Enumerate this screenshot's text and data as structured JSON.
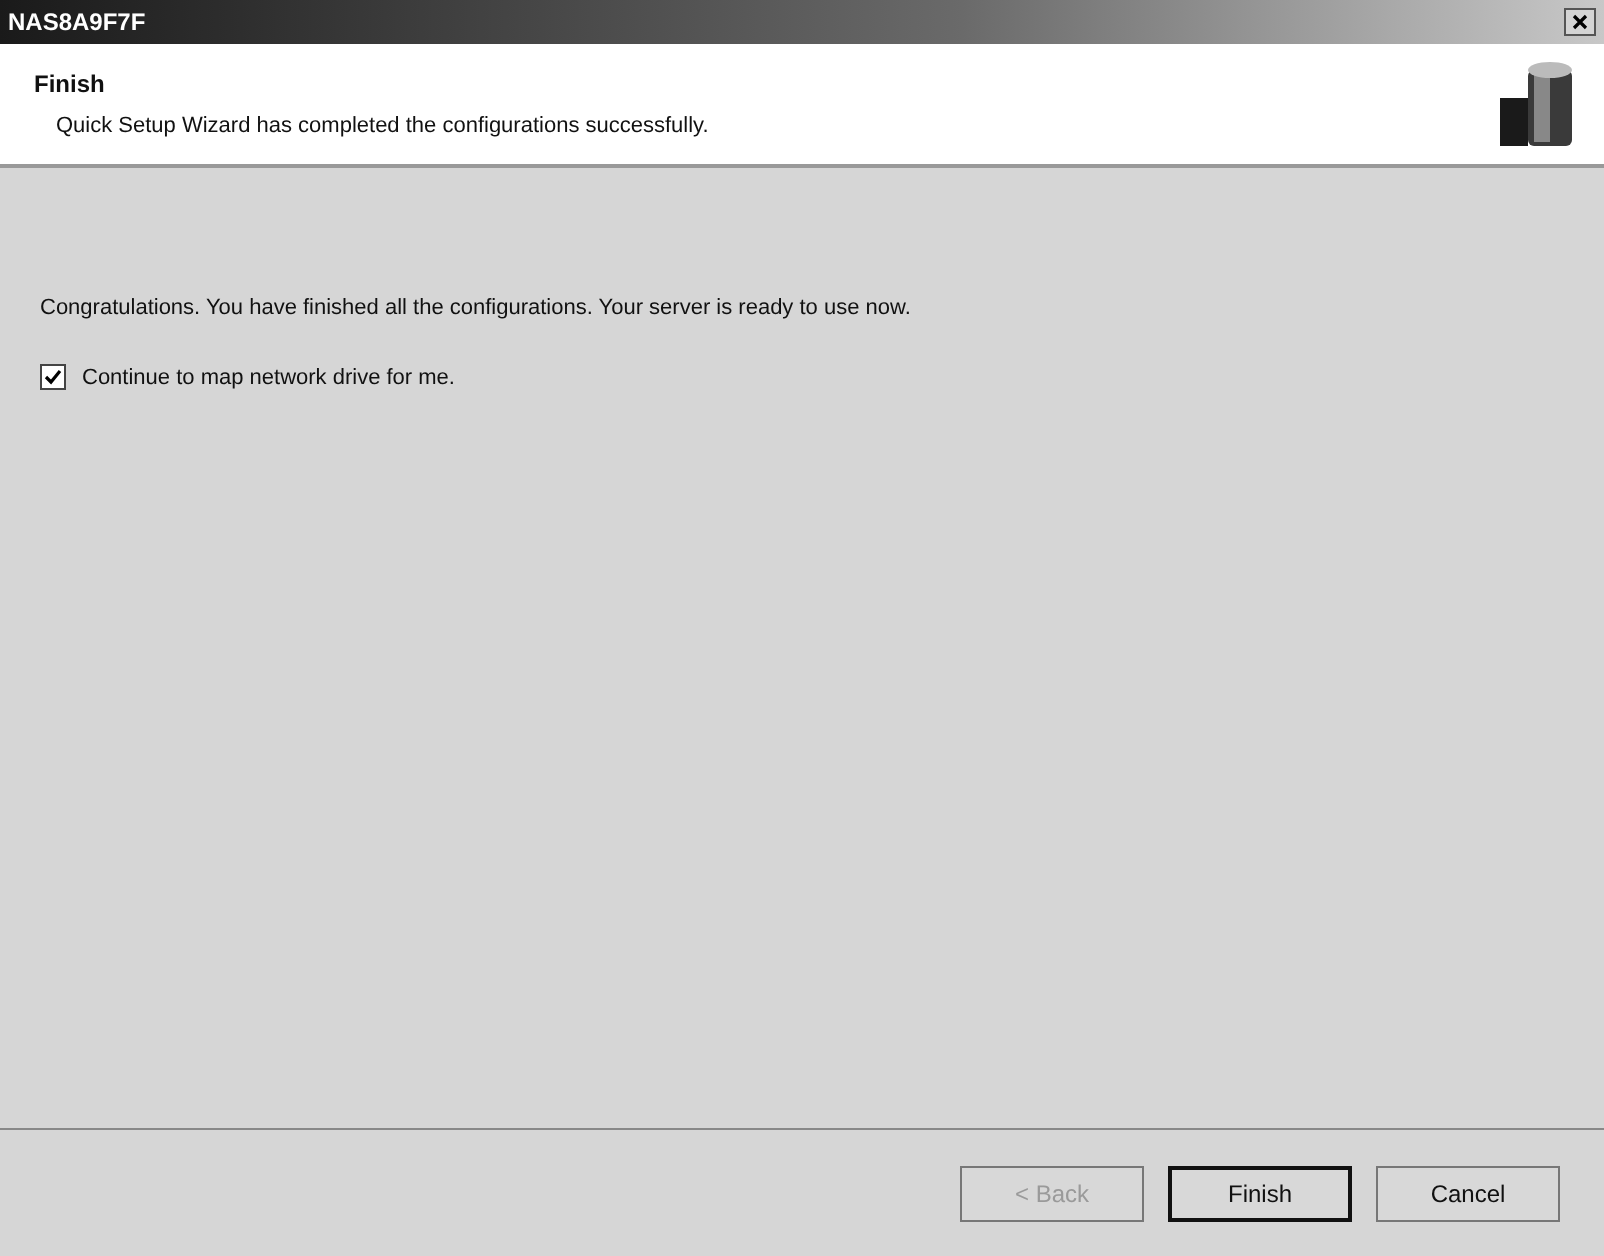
{
  "window": {
    "title": "NAS8A9F7F"
  },
  "header": {
    "title": "Finish",
    "subtitle": "Quick Setup Wizard has completed the configurations successfully."
  },
  "message": "Congratulations. You have finished all the configurations. Your server is ready to use now.",
  "checkbox": {
    "label": "Continue to map network drive for me.",
    "checked": true
  },
  "buttons": [
    {
      "label": "< Back",
      "disabled": true,
      "default": false
    },
    {
      "label": "Finish",
      "disabled": false,
      "default": true
    },
    {
      "label": "Cancel",
      "disabled": false,
      "default": false
    }
  ]
}
